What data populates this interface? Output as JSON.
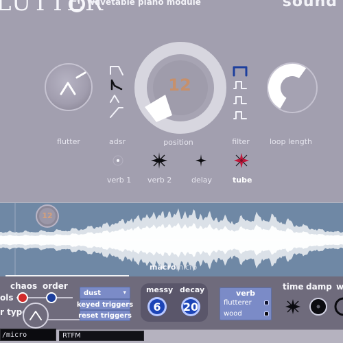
{
  "header": {
    "title": "LUTTER",
    "subtitle": "wavetable piano module",
    "brand": "sound"
  },
  "top_controls": {
    "flutter_label": "flutter",
    "adsr_label": "adsr",
    "position_label": "position",
    "position_value": "12",
    "filter_label": "filter",
    "loop_length_label": "loop length"
  },
  "fx": {
    "verb1": "verb 1",
    "verb2": "verb 2",
    "delay": "delay",
    "tube": "tube"
  },
  "wave": {
    "playhead_value": "12",
    "macro": "macro",
    "micro": "micro"
  },
  "lower": {
    "labels": {
      "chaos": "chaos",
      "order": "order",
      "ols": "ols",
      "r_type": "r type",
      "messy": "messy",
      "decay": "decay",
      "verb": "verb",
      "time": "time",
      "damp": "damp",
      "w": "w"
    },
    "mode_select_value": "dust",
    "keyed_triggers": "keyed triggers",
    "reset_triggers": "reset triggers",
    "messy_value": "6",
    "decay_value": "20",
    "verb_items": [
      "flutterer",
      "wood"
    ]
  },
  "bottom": {
    "path": "/micro",
    "rtfm": "RTFM"
  },
  "colors": {
    "panel_top": "#a29faf",
    "panel_lower": "#6f6b7c",
    "accent_blue": "#1c44b6",
    "accent_button": "#7b8bc7",
    "waveform": "#ffffff",
    "position_number": "#c7906b",
    "tube_red": "#c0183a"
  }
}
